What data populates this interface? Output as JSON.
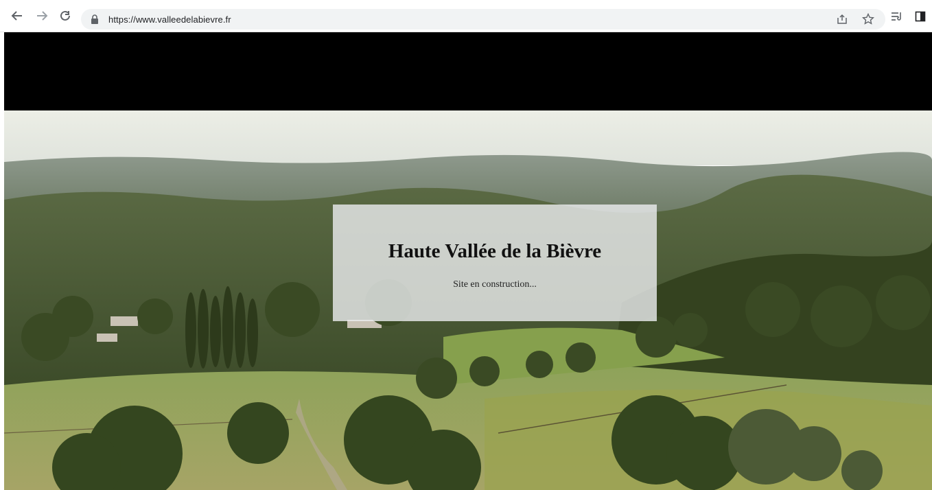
{
  "browser": {
    "url": "https://www.valleedelabievre.fr",
    "icons": [
      "back-icon",
      "forward-icon",
      "reload-icon",
      "lock-icon",
      "share-icon",
      "bookmark-star-icon",
      "reading-list-icon",
      "side-panel-icon"
    ]
  },
  "page": {
    "title": "Haute Vallée de la Bièvre",
    "subtitle": "Site en construction..."
  },
  "colors": {
    "top_band": "#000000",
    "card_overlay": "rgba(236,238,240,0.80)"
  }
}
